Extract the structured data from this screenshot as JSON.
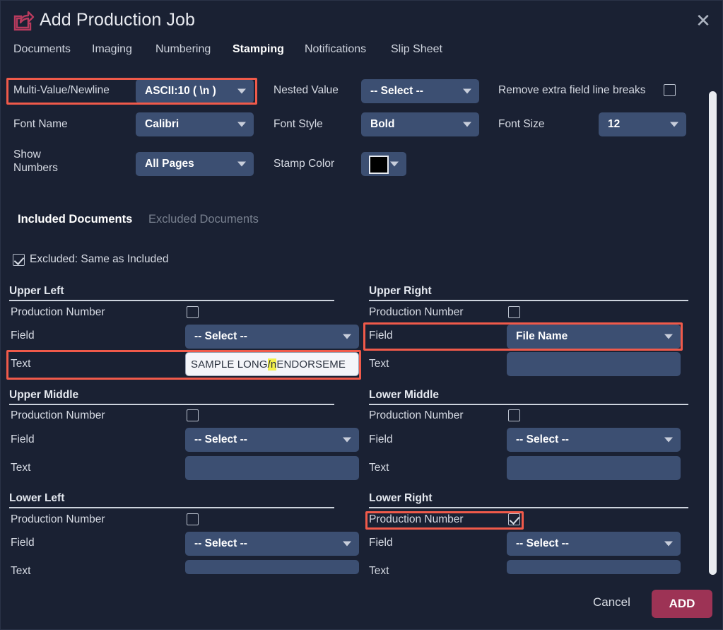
{
  "window": {
    "title": "Add Production Job",
    "title_icon": "share-export-icon",
    "close_icon": "✕",
    "accent_color": "#9d3355",
    "panel_color": "#1a2133",
    "field_color": "#3c4f72",
    "highlight_box_color": "#f05a4a",
    "text_highlight_color": "#f2f04a"
  },
  "tabs": [
    {
      "label": "Documents",
      "active": false
    },
    {
      "label": "Imaging",
      "active": false
    },
    {
      "label": "Numbering",
      "active": false
    },
    {
      "label": "Stamping",
      "active": true
    },
    {
      "label": "Notifications",
      "active": false
    },
    {
      "label": "Slip Sheet",
      "active": false
    }
  ],
  "settings": {
    "multi_value_newline": {
      "label": "Multi-Value/Newline",
      "value": "ASCII:10 ( \\n )"
    },
    "nested_value": {
      "label": "Nested Value",
      "value": "-- Select --"
    },
    "remove_line_breaks": {
      "label": "Remove extra field line breaks",
      "checked": false
    },
    "font_name": {
      "label": "Font Name",
      "value": "Calibri"
    },
    "font_style": {
      "label": "Font Style",
      "value": "Bold"
    },
    "font_size": {
      "label": "Font Size",
      "value": "12"
    },
    "show_numbers": {
      "label": "Show Numbers",
      "label_line1": "Show",
      "label_line2": "Numbers",
      "value": "All Pages"
    },
    "stamp_color": {
      "label": "Stamp Color",
      "value": "#000000"
    }
  },
  "doc_tabs": {
    "included": "Included Documents",
    "excluded": "Excluded Documents"
  },
  "excluded_same": {
    "label": "Excluded: Same as Included",
    "checked": true
  },
  "row_labels": {
    "production_number": "Production Number",
    "field": "Field",
    "text": "Text"
  },
  "sections": [
    {
      "id": "upper-left",
      "title": "Upper Left",
      "production_number_checked": false,
      "field_value": "-- Select --",
      "text_value": "SAMPLE LONG/nENDORSEME",
      "text_value_prefix": "SAMPLE LONG",
      "text_value_highlight": "/n",
      "text_value_suffix": "ENDORSEME",
      "text_is_white_input": true
    },
    {
      "id": "upper-right",
      "title": "Upper Right",
      "production_number_checked": false,
      "field_value": "File Name",
      "text_value": "",
      "text_is_white_input": false
    },
    {
      "id": "upper-middle",
      "title": "Upper Middle",
      "production_number_checked": false,
      "field_value": "-- Select --",
      "text_value": "",
      "text_is_white_input": false
    },
    {
      "id": "lower-middle",
      "title": "Lower Middle",
      "production_number_checked": false,
      "field_value": "-- Select --",
      "text_value": "",
      "text_is_white_input": false
    },
    {
      "id": "lower-left",
      "title": "Lower Left",
      "production_number_checked": false,
      "field_value": "-- Select --",
      "text_value": "",
      "text_is_white_input": false
    },
    {
      "id": "lower-right",
      "title": "Lower Right",
      "production_number_checked": true,
      "field_value": "-- Select --",
      "text_value": "",
      "text_is_white_input": false
    }
  ],
  "footer": {
    "cancel": "Cancel",
    "add": "ADD"
  }
}
